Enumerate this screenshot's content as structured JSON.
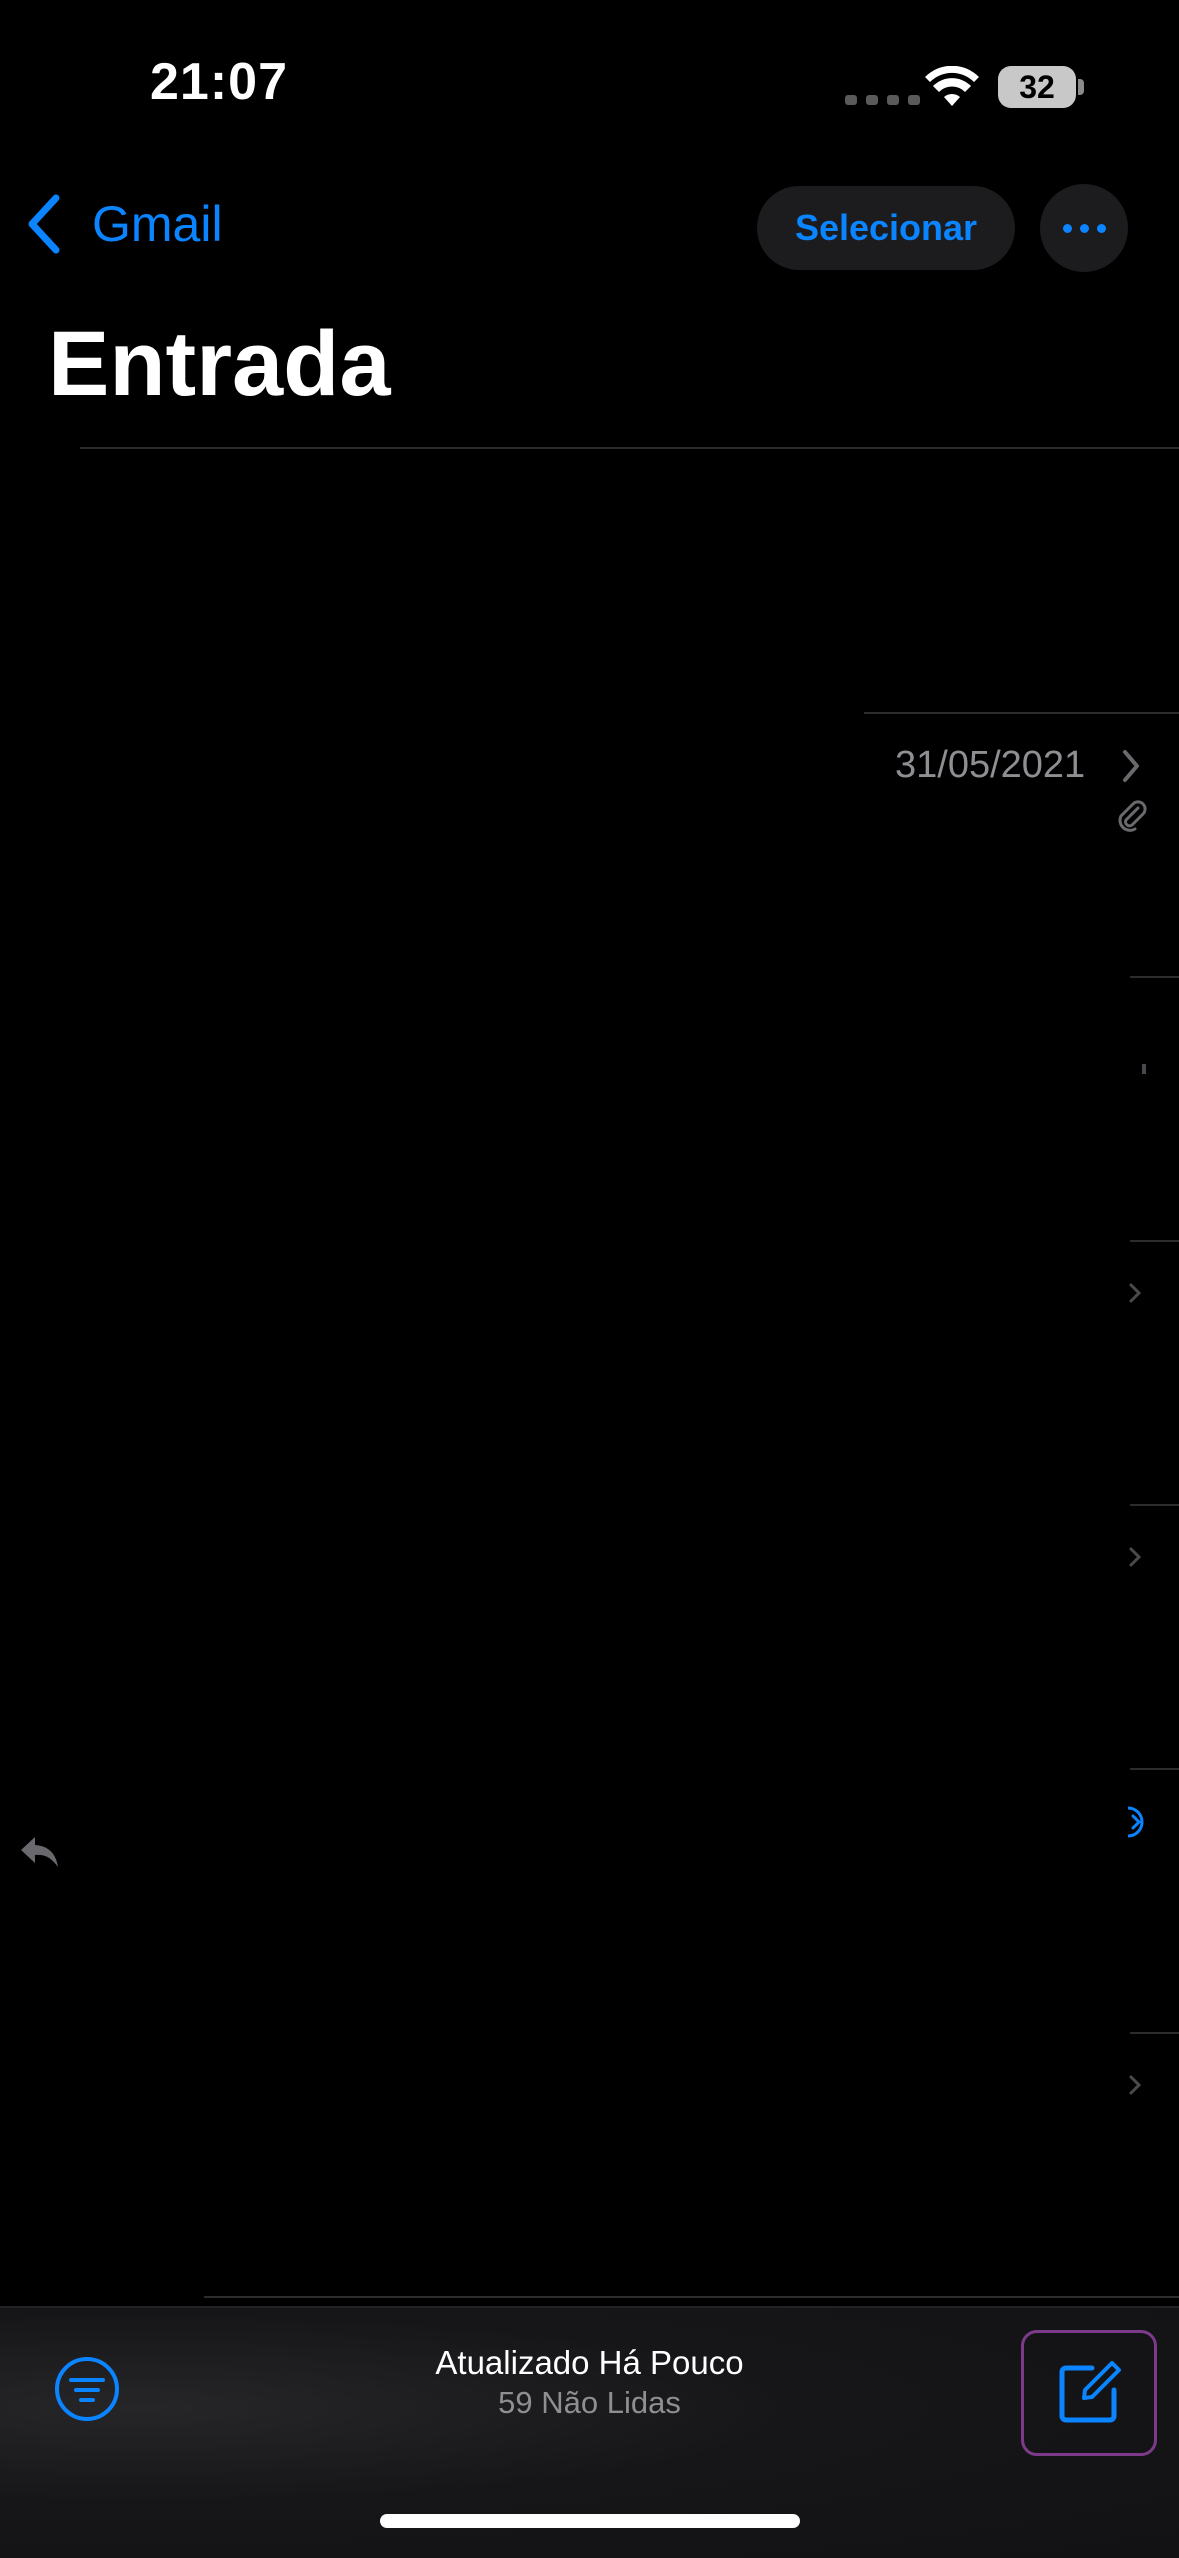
{
  "status_bar": {
    "time": "21:07",
    "battery": "32"
  },
  "nav": {
    "back_label": "Gmail",
    "select_label": "Selecionar",
    "title": "Entrada"
  },
  "list": {
    "date": "31/05/2021"
  },
  "toolbar": {
    "status_line1": "Atualizado Há Pouco",
    "status_line2": "59 Não Lidas"
  },
  "colors": {
    "accent": "#0a84ff",
    "background": "#000000",
    "secondary_text": "#8e8e93",
    "separator": "#2c2c2e",
    "compose_highlight": "#7e3a8a"
  },
  "icons": {
    "back": "chevron-left-icon",
    "more": "ellipsis-icon",
    "filter": "filter-icon",
    "compose": "compose-icon",
    "attachment": "paperclip-icon",
    "reply": "reply-icon"
  }
}
